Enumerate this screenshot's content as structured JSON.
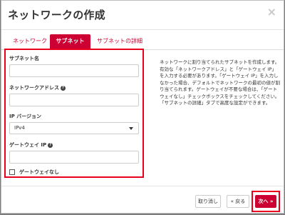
{
  "dialog": {
    "title": "ネットワークの作成",
    "close_glyph": "×"
  },
  "tabs": [
    {
      "label": "ネットワーク",
      "active": false
    },
    {
      "label": "サブネット",
      "active": true
    },
    {
      "label": "サブネットの詳細",
      "active": false
    }
  ],
  "form": {
    "subnet_name_label": "サブネット名",
    "subnet_name_value": "",
    "network_address_label": "ネットワークアドレス",
    "network_address_value": "",
    "ip_version_label": "IP バージョン",
    "ip_version_selected": "IPv4",
    "gateway_ip_label": "ゲートウェイ IP",
    "gateway_ip_value": "",
    "no_gateway_label": "ゲートウェイなし",
    "no_gateway_checked": false,
    "help_glyph": "?"
  },
  "description": "ネットワークに割り当てられたサブネットを作成します。有効な「ネットワークアドレス」と「ゲートウェイ IP」を入力する必要があります。「ゲートウェイ IP」を入力しなかった場合、デフォルトでネットワークの最初の値が割り当てられます。ゲートウェイが不要な場合は、「ゲートウェイなし」チェックボックスをチェックしてください。「サブネットの詳細」タブで高度な設定ができます。",
  "footer": {
    "cancel_label": "取り消し",
    "back_label": "« 戻る",
    "next_label": "次へ »"
  },
  "colors": {
    "accent": "#cc0033",
    "highlight_border": "#e8001c",
    "backdrop": "#7d7d7d"
  }
}
